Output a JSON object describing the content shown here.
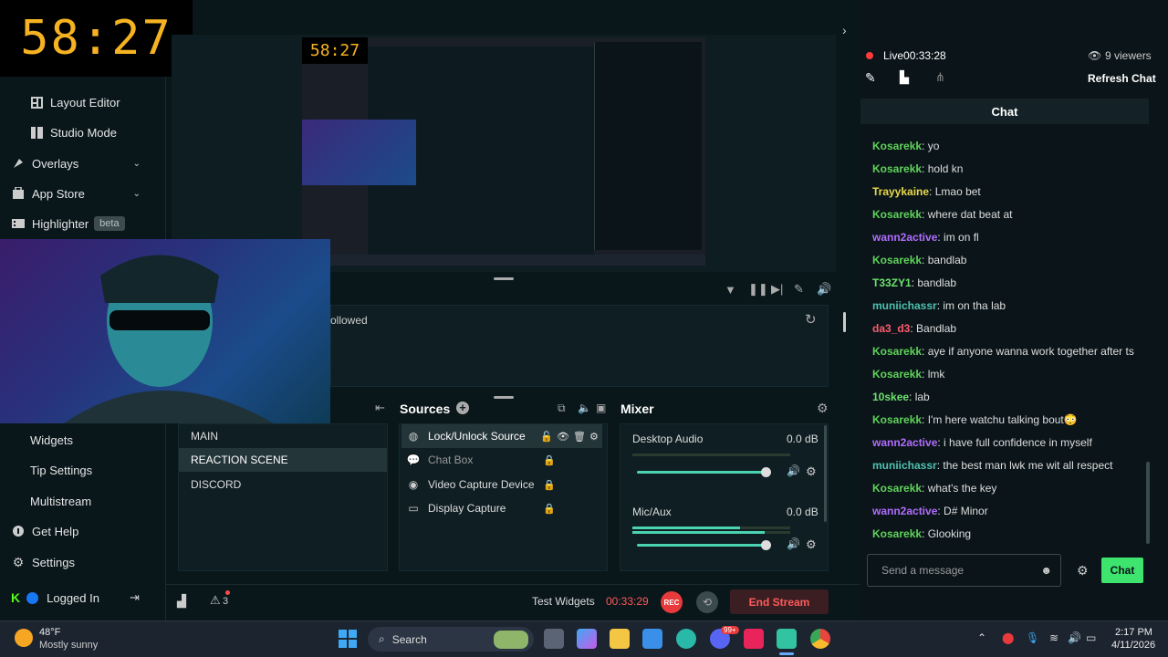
{
  "timer_overlay": "58:27",
  "sidebar": {
    "items": [
      {
        "label": "Layout Editor",
        "icon": "layout-icon"
      },
      {
        "label": "Studio Mode",
        "icon": "studio-icon"
      },
      {
        "label": "Overlays",
        "icon": "overlays-icon"
      },
      {
        "label": "App Store",
        "icon": "store-icon"
      },
      {
        "label": "Highlighter",
        "icon": "highlighter-icon",
        "badge": "beta"
      },
      {
        "label": "Widgets"
      },
      {
        "label": "Tip Settings"
      },
      {
        "label": "Multistream"
      },
      {
        "label": "Get Help",
        "icon": "help-icon"
      },
      {
        "label": "Settings",
        "icon": "gear-icon"
      },
      {
        "label": "Logged In",
        "icon": "login-icon"
      }
    ]
  },
  "preview": {
    "timer": "58:27",
    "events_text": "ollowed"
  },
  "scenes": [
    "MAIN",
    "REACTION SCENE",
    "DISCORD"
  ],
  "sources": {
    "title": "Sources",
    "tooltip": "Lock/Unlock Source",
    "items": [
      "Chat Box",
      "Video Capture Device",
      "Display Capture"
    ]
  },
  "mixer": {
    "title": "Mixer",
    "channels": [
      {
        "name": "Desktop Audio",
        "db": "0.0 dB"
      },
      {
        "name": "Mic/Aux",
        "db": "0.0 dB"
      }
    ]
  },
  "footer": {
    "alerts_count": "3",
    "test_widgets": "Test Widgets",
    "stream_time": "00:33:29",
    "rec_label": "REC",
    "end_stream": "End Stream"
  },
  "chat": {
    "live_label": "Live",
    "live_time": "00:33:28",
    "viewers": "9 viewers",
    "refresh": "Refresh Chat",
    "title": "Chat",
    "input_placeholder": "Send a message",
    "send_label": "Chat",
    "messages": [
      {
        "user": "Kosarekk",
        "text": "yo",
        "color": "#5fd35a"
      },
      {
        "user": "Kosarekk",
        "text": "hold kn",
        "color": "#5fd35a"
      },
      {
        "user": "Trayykaine",
        "text": "Lmao bet",
        "color": "#e8d84a"
      },
      {
        "user": "Kosarekk",
        "text": "where dat beat at",
        "color": "#5fd35a"
      },
      {
        "user": "wann2active",
        "text": "im on fl",
        "color": "#b16cff"
      },
      {
        "user": "Kosarekk",
        "text": "bandlab",
        "color": "#5fd35a"
      },
      {
        "user": "T33ZY1",
        "text": "bandlab",
        "color": "#6ee06e"
      },
      {
        "user": "muniichassr",
        "text": "im on tha lab",
        "color": "#4fc0b0"
      },
      {
        "user": "da3_d3",
        "text": "Bandlab",
        "color": "#ff5a6e"
      },
      {
        "user": "Kosarekk",
        "text": "aye if anyone wanna work together after ts",
        "color": "#5fd35a"
      },
      {
        "user": "Kosarekk",
        "text": "lmk",
        "color": "#5fd35a"
      },
      {
        "user": "10skee",
        "text": "lab",
        "color": "#6ee06e"
      },
      {
        "user": "Kosarekk",
        "text": "I'm here watchu talking bout😳",
        "color": "#5fd35a"
      },
      {
        "user": "wann2active",
        "text": "i have full confidence in myself",
        "color": "#b16cff"
      },
      {
        "user": "muniichassr",
        "text": "the best man lwk me wit all respect",
        "color": "#4fc0b0"
      },
      {
        "user": "Kosarekk",
        "text": "what's the key",
        "color": "#5fd35a"
      },
      {
        "user": "wann2active",
        "text": "D# Minor",
        "color": "#b16cff"
      },
      {
        "user": "Kosarekk",
        "text": "Glooking",
        "color": "#5fd35a"
      }
    ]
  },
  "taskbar": {
    "weather_temp": "48°F",
    "weather_desc": "Mostly sunny",
    "search_label": "Search",
    "time": "2:17 PM",
    "date": "4/11/2026",
    "notif_badge": "99+"
  },
  "colors": {
    "accent": "#4bd3b1",
    "chat_send": "#3de46e",
    "end_stream": "#ff5a5a",
    "timer": "#f6b321"
  }
}
